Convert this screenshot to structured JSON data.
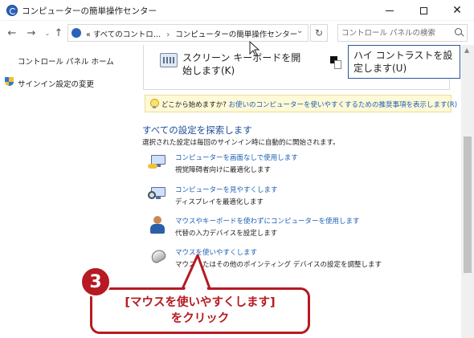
{
  "window": {
    "title": "コンピューターの簡単操作センター",
    "controls": {
      "minimize": "—",
      "maximize": "☐",
      "close": "✕"
    }
  },
  "nav": {
    "back": "←",
    "forward": "→",
    "history": "⌄",
    "up": "↑",
    "breadcrumb": [
      "«",
      "すべてのコントロ…",
      "›",
      "コンピューターの簡単操作センター"
    ],
    "dropdown": "⌄",
    "refresh": "↻",
    "search_placeholder": "コントロール パネルの検索"
  },
  "left_pane": {
    "home_link": "コントロール パネル ホーム",
    "signin_link": "サインイン設定の変更"
  },
  "top_actions": {
    "keyboard_label": "スクリーン キーボードを開始します(K)",
    "high_contrast_label": "ハイ コントラストを設定します(U)"
  },
  "tip": {
    "question": "どこから始めますか?",
    "link": "お使いのコンピューターを使いやすくするための推奨事項を表示します(R)"
  },
  "explore": {
    "heading": "すべての設定を探索します",
    "subtext": "選択された設定は毎回のサインイン時に自動的に開始されます。",
    "settings": [
      {
        "link": "コンピューターを画面なしで使用します",
        "desc": "視覚障碍者向けに最適化します",
        "icon": "monitor-speech-icon"
      },
      {
        "link": "コンピューターを見やすくします",
        "desc": "ディスプレイを最適化します",
        "icon": "magnifier-monitor-icon"
      },
      {
        "link": "マウスやキーボードを使わずにコンピューターを使用します",
        "desc": "代替の入力デバイスを設定します",
        "icon": "person-icon"
      },
      {
        "link": "マウスを使いやすくします",
        "desc": "マウスまたはその他のポインティング デバイスの設定を調整します",
        "icon": "mouse-icon"
      }
    ]
  },
  "annotation": {
    "step_number": "3",
    "line1": "[マウスを使いやすくします]",
    "line2": "をクリック"
  },
  "colors": {
    "link": "#1a5fb4",
    "heading": "#1c4f9c",
    "callout": "#b61a22",
    "tip_bg": "#fff9d6"
  }
}
